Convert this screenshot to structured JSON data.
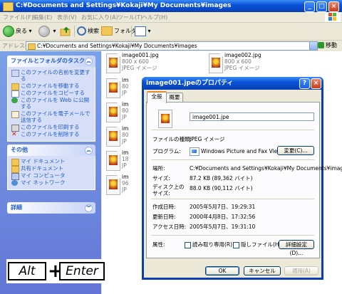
{
  "explorer": {
    "title": "C:¥Documents and Settings¥Kokaji¥My Documents¥images",
    "menu": [
      "ファイル(F)",
      "編集(E)",
      "表示(V)",
      "お気に入り(A)",
      "ツール(T)",
      "ヘルプ(H)"
    ],
    "toolbar": {
      "back_label": "戻る",
      "search_label": "検索",
      "folders_label": "フォルダ"
    },
    "address": {
      "label": "アドレス(D)",
      "value": "C:¥Documents and Settings¥Kokaji¥My Documents¥images",
      "go_label": "移動"
    }
  },
  "taskpane": {
    "file_tasks": {
      "title": "ファイルとフォルダのタスク",
      "items": [
        "このファイルの名前を変更する",
        "このファイルを移動する",
        "このファイルをコピーする",
        "このファイルを Web に公開する",
        "このファイルを電子メールで送信する",
        "このファイルを印刷する",
        "このファイルを削除する"
      ]
    },
    "other_places": {
      "title": "その他",
      "items": [
        "マイ ドキュメント",
        "共有ドキュメント",
        "マイ コンピュータ",
        "マイ ネットワーク"
      ]
    },
    "details": {
      "title": "詳細"
    }
  },
  "files": [
    {
      "name": "image001.jpg",
      "dims": "800 x 600",
      "type": "JPEG イメージ"
    },
    {
      "name": "image002.jpg",
      "dims": "800 x 600",
      "type": "JPEG イメージ"
    },
    {
      "name": "im",
      "dims": "80",
      "type": "JP"
    },
    {
      "name": "im",
      "dims": "80",
      "type": "JP"
    },
    {
      "name": "im",
      "dims": "80",
      "type": "JP"
    },
    {
      "name": "im",
      "dims": "18",
      "type": "JP"
    },
    {
      "name": "im",
      "dims": "96",
      "type": "JP"
    }
  ],
  "dialog": {
    "title": "image001.jpeのプロパティ",
    "tabs": [
      "全般",
      "概要"
    ],
    "filename": "image001.jpe",
    "fields": {
      "type_label": "ファイルの種類:",
      "type_value": "JPEG イメージ",
      "program_label": "プログラム:",
      "program_value": "Windows Picture and Fax Viewer",
      "change_label": "変更(C)...",
      "location_label": "場所:",
      "location_value": "C:¥Documents and Settings¥Kokaji¥My Documents¥imag",
      "size_label": "サイズ:",
      "size_value": "87.2 KB (89,362 バイト)",
      "disk_size_label": "ディスク上のサイズ:",
      "disk_size_value": "88.0 KB (90,112 バイト)",
      "created_label": "作成日時:",
      "created_value": "2005年5月7日、19:29:31",
      "modified_label": "更新日時:",
      "modified_value": "2000年4月8日、17:32:56",
      "accessed_label": "アクセス日時:",
      "accessed_value": "2005年5月7日、19:31:10",
      "attributes_label": "属性:",
      "readonly_label": "読み取り専用(R)",
      "hidden_label": "隠しファイル(H)",
      "advanced_label": "詳細設定(D)..."
    },
    "buttons": {
      "ok": "OK",
      "cancel": "キャンセル",
      "apply": "適用(A)"
    }
  },
  "shortcut": {
    "key1": "Alt",
    "plus": "+",
    "key2": "Enter"
  }
}
